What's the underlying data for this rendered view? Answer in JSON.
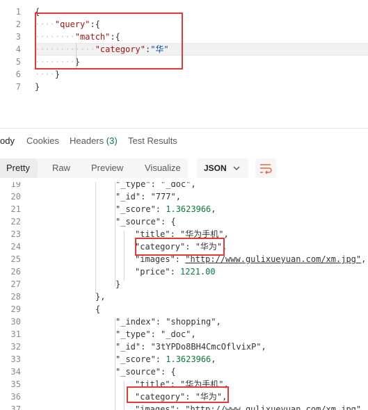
{
  "request_body": {
    "lines": [
      {
        "n": "1",
        "dots": "",
        "text": "{"
      },
      {
        "n": "2",
        "dots": "····",
        "key": "\"query\"",
        "rest": ":{"
      },
      {
        "n": "3",
        "dots": "········",
        "key": "\"match\"",
        "rest": ":{"
      },
      {
        "n": "4",
        "dots": "············",
        "key": "\"category\"",
        "rest": ":",
        "value": "\"华\""
      },
      {
        "n": "5",
        "dots": "········",
        "text": "}"
      },
      {
        "n": "6",
        "dots": "····",
        "text": "}"
      },
      {
        "n": "7",
        "dots": "",
        "text": "}"
      }
    ]
  },
  "tabs": {
    "body": "ody",
    "cookies": "Cookies",
    "headers": "Headers",
    "headers_count": "(3)",
    "test_results": "Test Results"
  },
  "toolbar": {
    "pretty": "Pretty",
    "raw": "Raw",
    "preview": "Preview",
    "visualize": "Visualize",
    "format": "JSON"
  },
  "response": {
    "lines": [
      {
        "n": "19",
        "text": "\"_type\": \"_doc\","
      },
      {
        "n": "20",
        "text": "\"_id\": \"777\","
      },
      {
        "n": "21",
        "key": "\"_score\": ",
        "num": "1.3623966",
        "tail": ","
      },
      {
        "n": "22",
        "text": "\"_source\": {"
      },
      {
        "n": "23",
        "text": "\"title\": \"华为手机\","
      },
      {
        "n": "24",
        "text": "\"category\": \"华为\","
      },
      {
        "n": "25",
        "key": "\"images\": ",
        "link": "\"http://www.gulixueyuan.com/xm.jpg\"",
        "tail": ","
      },
      {
        "n": "26",
        "key": "\"price\": ",
        "num": "1221.00"
      },
      {
        "n": "27",
        "text": "}"
      },
      {
        "n": "28",
        "text": "},"
      },
      {
        "n": "29",
        "text": "{"
      },
      {
        "n": "30",
        "text": "\"_index\": \"shopping\","
      },
      {
        "n": "31",
        "text": "\"_type\": \"_doc\","
      },
      {
        "n": "32",
        "text": "\"_id\": \"3tYPDo8BH4CmcOflvixP\","
      },
      {
        "n": "33",
        "key": "\"_score\": ",
        "num": "1.3623966",
        "tail": ","
      },
      {
        "n": "34",
        "text": "\"_source\": {"
      },
      {
        "n": "35",
        "text": "\"title\": \"华为手机\","
      },
      {
        "n": "36",
        "text": "\"category\": \"华为\","
      },
      {
        "n": "37",
        "key": "\"images\": ",
        "link": "\"http://www.gulixueyuan.com/xm.jpg\"",
        "tail": ","
      }
    ]
  },
  "colors": {
    "highlight": "#e53935",
    "number": "#0b7a3e"
  }
}
